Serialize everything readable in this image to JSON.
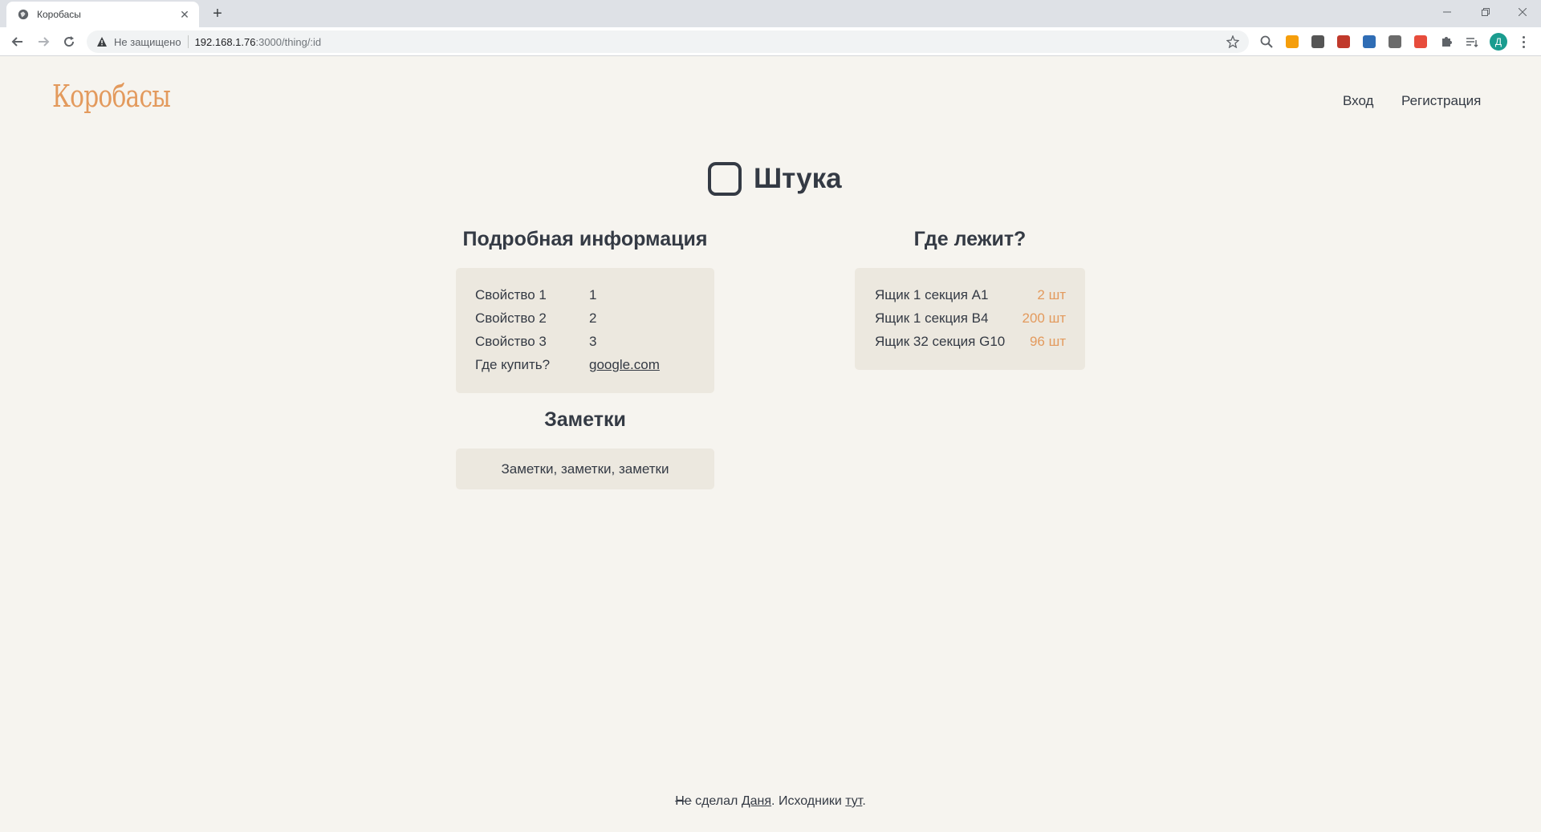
{
  "browser": {
    "tab_title": "Коробасы",
    "security_label": "Не защищено",
    "url_host": "192.168.1.76",
    "url_path": ":3000/thing/:id",
    "profile_initial": "Д",
    "extension_colors": [
      "#f59e0b",
      "#555555",
      "#c0392b",
      "#2f6db5",
      "#6b6b6b",
      "#e74c3c"
    ]
  },
  "header": {
    "logo": "Коробасы",
    "nav": {
      "login": "Вход",
      "register": "Регистрация"
    }
  },
  "thing": {
    "title": "Штука",
    "details_title": "Подробная информация",
    "properties": [
      {
        "label": "Свойство 1",
        "value": "1"
      },
      {
        "label": "Свойство 2",
        "value": "2"
      },
      {
        "label": "Свойство 3",
        "value": "3"
      },
      {
        "label": "Где купить?",
        "value": "google.com"
      }
    ],
    "notes_title": "Заметки",
    "notes": "Заметки, заметки, заметки",
    "location_title": "Где лежит?",
    "locations": [
      {
        "name": "Ящик 1 секция A1",
        "qty": "2 шт"
      },
      {
        "name": "Ящик 1 секция B4",
        "qty": "200 шт"
      },
      {
        "name": "Ящик 32 секция G10",
        "qty": "96 шт"
      }
    ]
  },
  "footer": {
    "not": "Не",
    "made": " сделал ",
    "author": "Даня",
    "sources": ". Исходники ",
    "here": "тут",
    "end": "."
  },
  "colors": {
    "accent": "#e39a5d",
    "text": "#343a44",
    "card": "#ece8df",
    "background": "#f6f4ef"
  }
}
